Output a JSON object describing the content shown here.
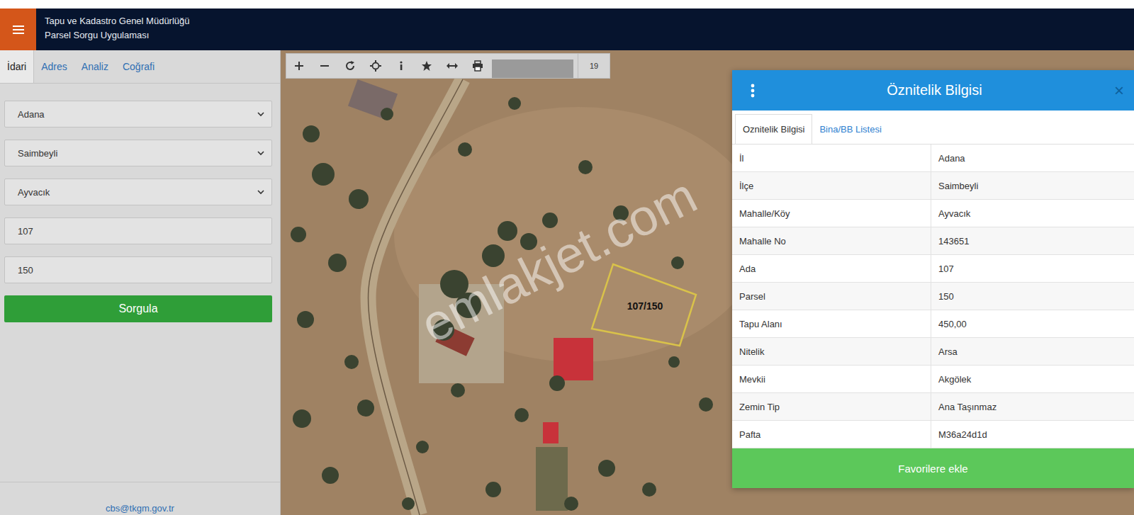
{
  "header": {
    "title": "Tapu ve Kadastro Genel Müdürlüğü",
    "subtitle": "Parsel Sorgu Uygulaması"
  },
  "sidebar": {
    "tabs": [
      {
        "label": "İdari",
        "selected": true
      },
      {
        "label": "Adres",
        "selected": false
      },
      {
        "label": "Analiz",
        "selected": false
      },
      {
        "label": "Coğrafi",
        "selected": false
      }
    ],
    "fields": [
      {
        "kind": "select",
        "value": "Adana"
      },
      {
        "kind": "select",
        "value": "Saimbeyli"
      },
      {
        "kind": "select",
        "value": "Ayvacık"
      },
      {
        "kind": "input",
        "value": "107"
      },
      {
        "kind": "input",
        "value": "150"
      }
    ],
    "submit": "Sorgula",
    "footer": "cbs@tkgm.gov.tr"
  },
  "map": {
    "zoom": "19",
    "parcel_label": "107/150",
    "watermark": "emlakjet.com"
  },
  "attributes": {
    "title": "Öznitelik Bilgisi",
    "close": "×",
    "tabs": [
      {
        "label": "Oznitelik Bilgisi",
        "selected": true
      },
      {
        "label": "Bina/BB Listesi",
        "selected": false
      }
    ],
    "rows": [
      {
        "key": "İl",
        "value": "Adana"
      },
      {
        "key": "İlçe",
        "value": "Saimbeyli"
      },
      {
        "key": "Mahalle/Köy",
        "value": "Ayvacık"
      },
      {
        "key": "Mahalle No",
        "value": "143651"
      },
      {
        "key": "Ada",
        "value": "107"
      },
      {
        "key": "Parsel",
        "value": "150"
      },
      {
        "key": "Tapu Alanı",
        "value": "450,00"
      },
      {
        "key": "Nitelik",
        "value": "Arsa"
      },
      {
        "key": "Mevkii",
        "value": "Akgölek"
      },
      {
        "key": "Zemin Tip",
        "value": "Ana Taşınmaz"
      },
      {
        "key": "Pafta",
        "value": "M36a24d1d"
      }
    ],
    "button": "Favorilere ekle"
  }
}
